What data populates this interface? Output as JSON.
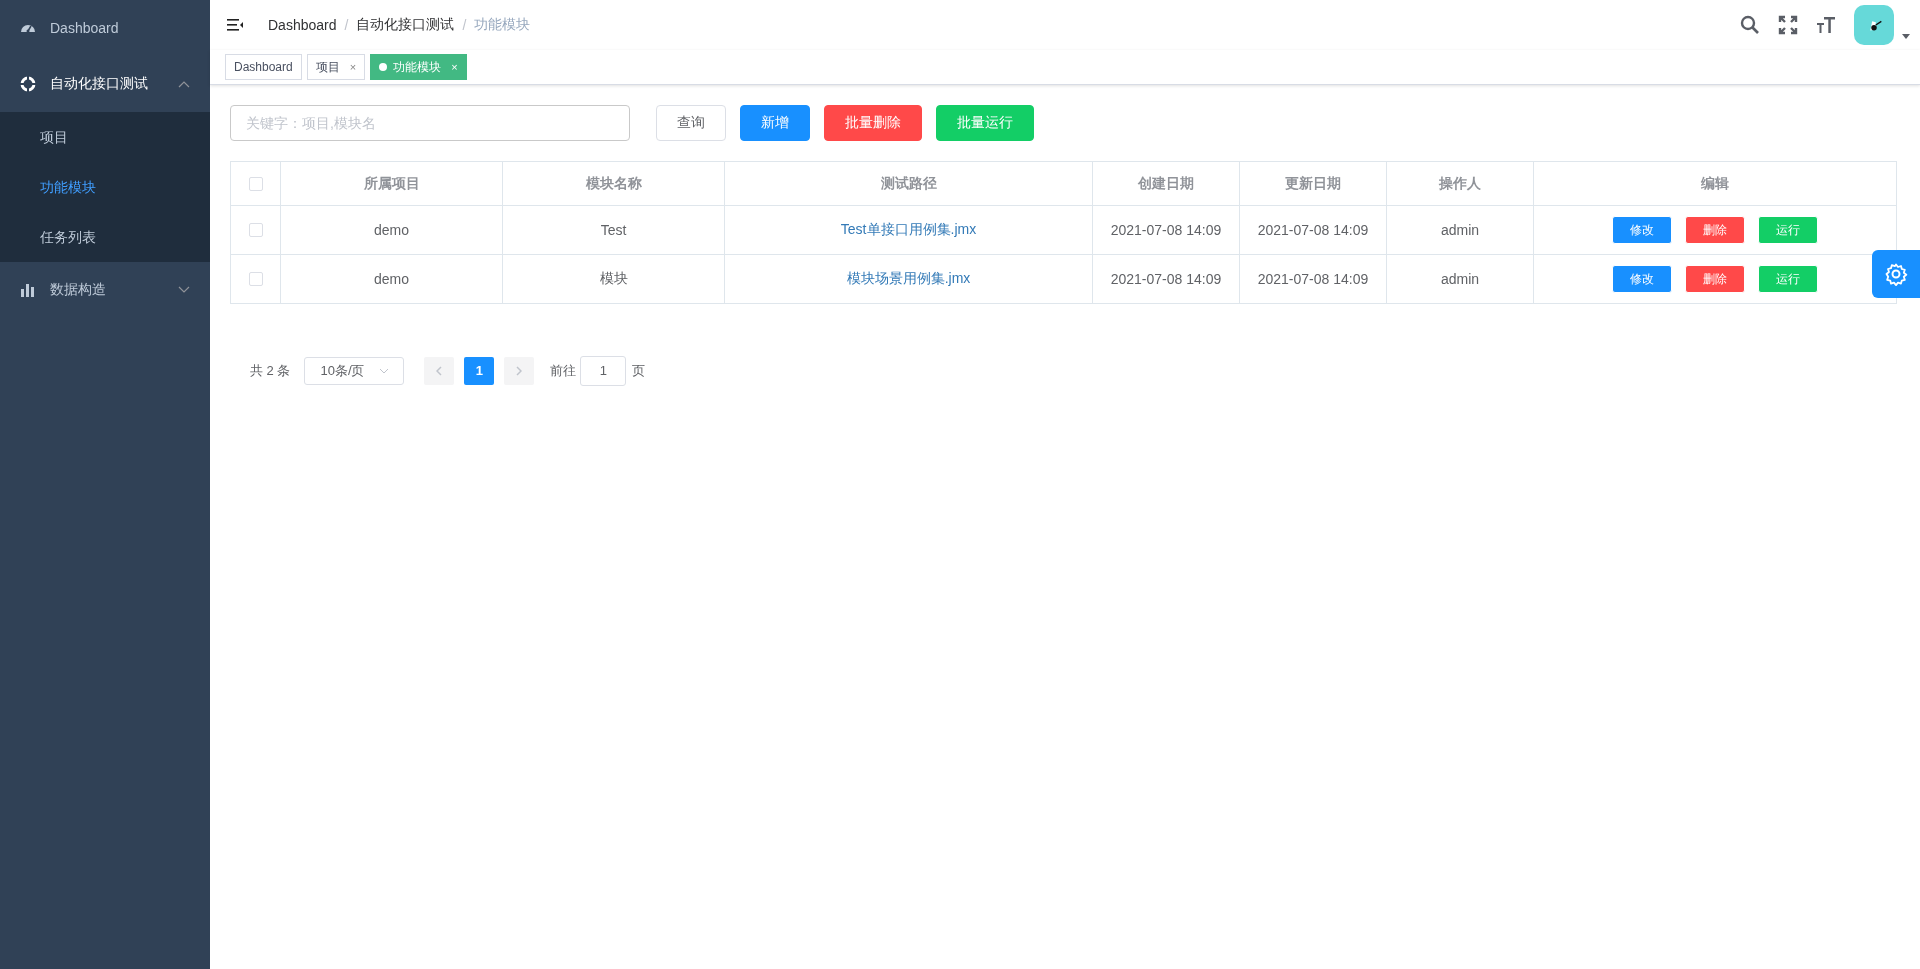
{
  "sidebar": {
    "items": [
      {
        "label": "Dashboard"
      },
      {
        "label": "自动化接口测试",
        "expanded": true,
        "children": [
          {
            "label": "项目",
            "selected": false
          },
          {
            "label": "功能模块",
            "selected": true
          },
          {
            "label": "任务列表",
            "selected": false
          }
        ]
      },
      {
        "label": "数据构造",
        "expanded": false
      }
    ]
  },
  "breadcrumb": [
    {
      "label": "Dashboard"
    },
    {
      "sep": "/",
      "label": "自动化接口测试"
    },
    {
      "sep": "/",
      "label": "功能模块"
    }
  ],
  "tags": [
    {
      "label": "Dashboard",
      "selected": false
    },
    {
      "label": "项目",
      "selected": false,
      "close": "×"
    },
    {
      "label": "功能模块",
      "selected": true,
      "close": "×"
    }
  ],
  "search": {
    "placeholder": "关键字：项目,模块名"
  },
  "toolbar": [
    {
      "label": "查询",
      "kind": "plain"
    },
    {
      "label": "新增",
      "kind": "primary"
    },
    {
      "label": "批量删除",
      "kind": "danger"
    },
    {
      "label": "批量运行",
      "kind": "success"
    }
  ],
  "table": {
    "columns": [
      "所属项目",
      "模块名称",
      "测试路径",
      "创建日期",
      "更新日期",
      "操作人",
      "编辑"
    ],
    "all_checked": false,
    "rows": [
      {
        "checked": false,
        "project": "demo",
        "module": "Test",
        "path": "Test单接口用例集.jmx",
        "created": "2021-07-08 14:09",
        "updated": "2021-07-08 14:09",
        "operator": "admin",
        "actions": [
          {
            "label": "修改",
            "kind": "primary"
          },
          {
            "label": "删除",
            "kind": "danger"
          },
          {
            "label": "运行",
            "kind": "success"
          }
        ]
      },
      {
        "checked": false,
        "project": "demo",
        "module": "模块",
        "path": "模块场景用例集.jmx",
        "created": "2021-07-08 14:09",
        "updated": "2021-07-08 14:09",
        "operator": "admin",
        "actions": [
          {
            "label": "修改",
            "kind": "primary"
          },
          {
            "label": "删除",
            "kind": "danger"
          },
          {
            "label": "运行",
            "kind": "success"
          }
        ]
      }
    ]
  },
  "pagination": {
    "total": "共 2 条",
    "page_size": "10条/页",
    "pages": [
      {
        "label": "1",
        "selected": true
      }
    ],
    "goto_label": "前往",
    "goto_value": "1",
    "goto_suffix": "页"
  }
}
